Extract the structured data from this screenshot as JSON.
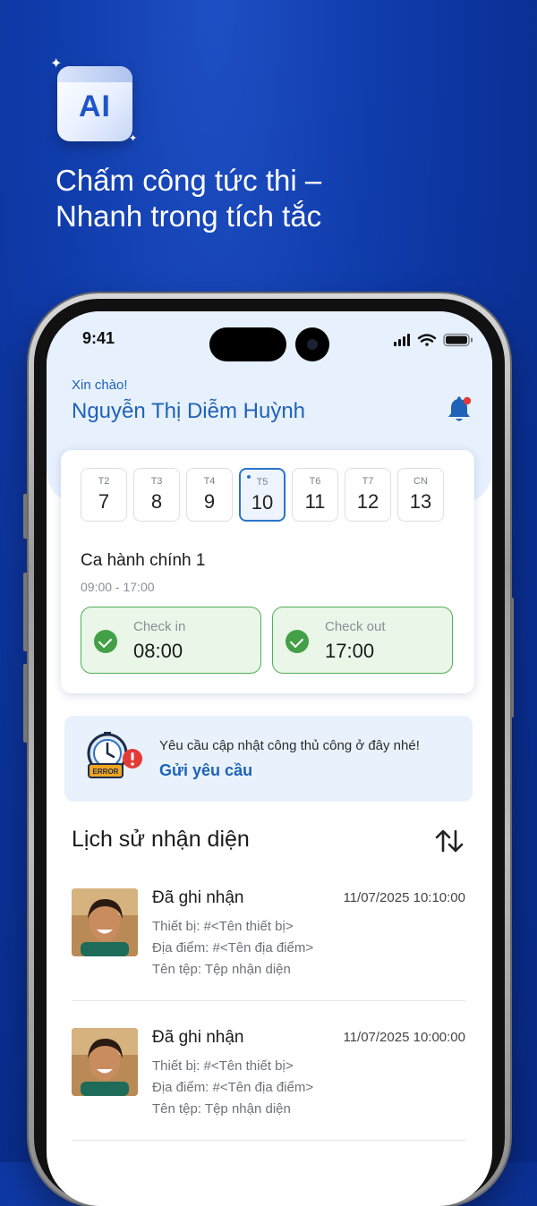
{
  "promo": {
    "logo_text": "AI",
    "headline_line1": "Chấm công tức thi –",
    "headline_line2": "Nhanh trong tích tắc"
  },
  "status_bar": {
    "time": "9:41"
  },
  "header": {
    "greeting": "Xin chào!",
    "user_name": "Nguyễn Thị Diễm Huỳnh"
  },
  "week": [
    {
      "dow": "T2",
      "day": "7",
      "active": false
    },
    {
      "dow": "T3",
      "day": "8",
      "active": false
    },
    {
      "dow": "T4",
      "day": "9",
      "active": false
    },
    {
      "dow": "T5",
      "day": "10",
      "active": true
    },
    {
      "dow": "T6",
      "day": "11",
      "active": false
    },
    {
      "dow": "T7",
      "day": "12",
      "active": false
    },
    {
      "dow": "CN",
      "day": "13",
      "active": false
    }
  ],
  "shift": {
    "name": "Ca hành chính 1",
    "time": "09:00 - 17:00",
    "check_in_label": "Check in",
    "check_in_value": "08:00",
    "check_out_label": "Check out",
    "check_out_value": "17:00"
  },
  "request": {
    "text": "Yêu cầu cập nhật công thủ công ở đây nhé!",
    "link": "Gửi yêu cầu",
    "illustration_text": "ERROR"
  },
  "history": {
    "title": "Lịch sử nhận diện",
    "records": [
      {
        "status": "Đã ghi nhận",
        "timestamp": "11/07/2025 10:10:00",
        "device": "Thiết bị: #<Tên thiết bị>",
        "location": "Địa điểm: #<Tên địa điểm>",
        "file": "Tên tệp: Tệp nhận diện"
      },
      {
        "status": "Đã ghi nhận",
        "timestamp": "11/07/2025 10:00:00",
        "device": "Thiết bị: #<Tên thiết bị>",
        "location": "Địa điểm: #<Tên địa điểm>",
        "file": "Tên tệp: Tệp nhận diện"
      }
    ]
  },
  "colors": {
    "background": "#0d379f",
    "accent_blue": "#1e63b8",
    "success_green": "#43a047",
    "alert_red": "#e53935"
  }
}
